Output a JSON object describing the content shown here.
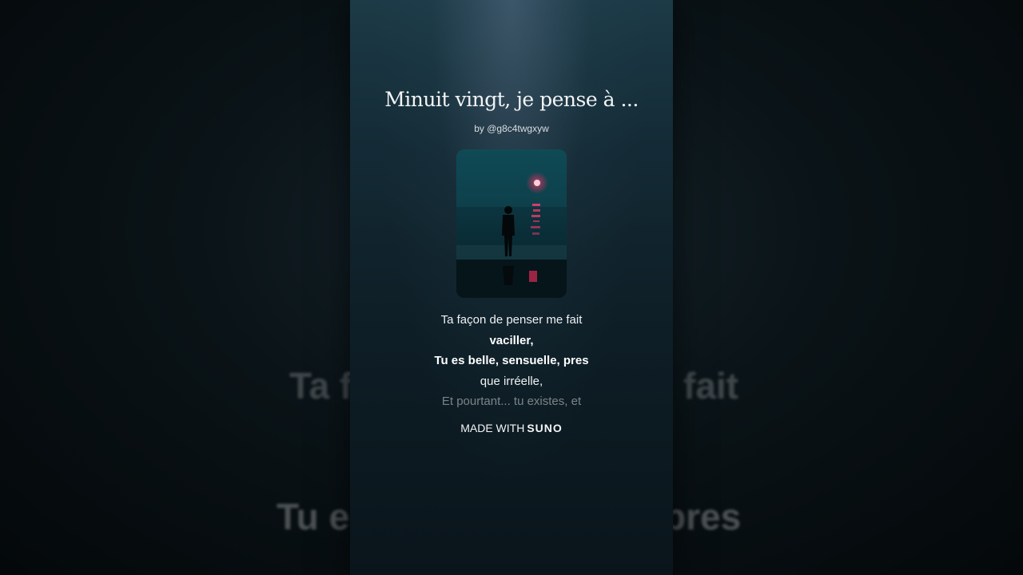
{
  "song": {
    "title": "Minuit vingt, je pense à ...",
    "byline": "by @g8c4twgxyw"
  },
  "lyrics": {
    "lines": [
      {
        "text": "Ta façon de penser me fait",
        "style": "normal"
      },
      {
        "text": "vaciller,",
        "style": "bold"
      },
      {
        "text": "Tu es belle, sensuelle, pres",
        "style": "bold"
      },
      {
        "text": "que irréelle,",
        "style": "normal"
      },
      {
        "text": "Et pourtant... tu existes, et",
        "style": "dim"
      }
    ]
  },
  "footer": {
    "made_with_label": "MADE WITH",
    "brand_label": "SUNO"
  },
  "background_text": {
    "line1_left": "Ta fa",
    "line1_right": "fait",
    "line2_left": "Tu e",
    "line2_right": "pres"
  },
  "colors": {
    "panel_top": "#1c3a47",
    "panel_bottom": "#0a151b",
    "sun": "#ff3b6b"
  },
  "icons": {
    "cover_art": "cover-art-image"
  }
}
